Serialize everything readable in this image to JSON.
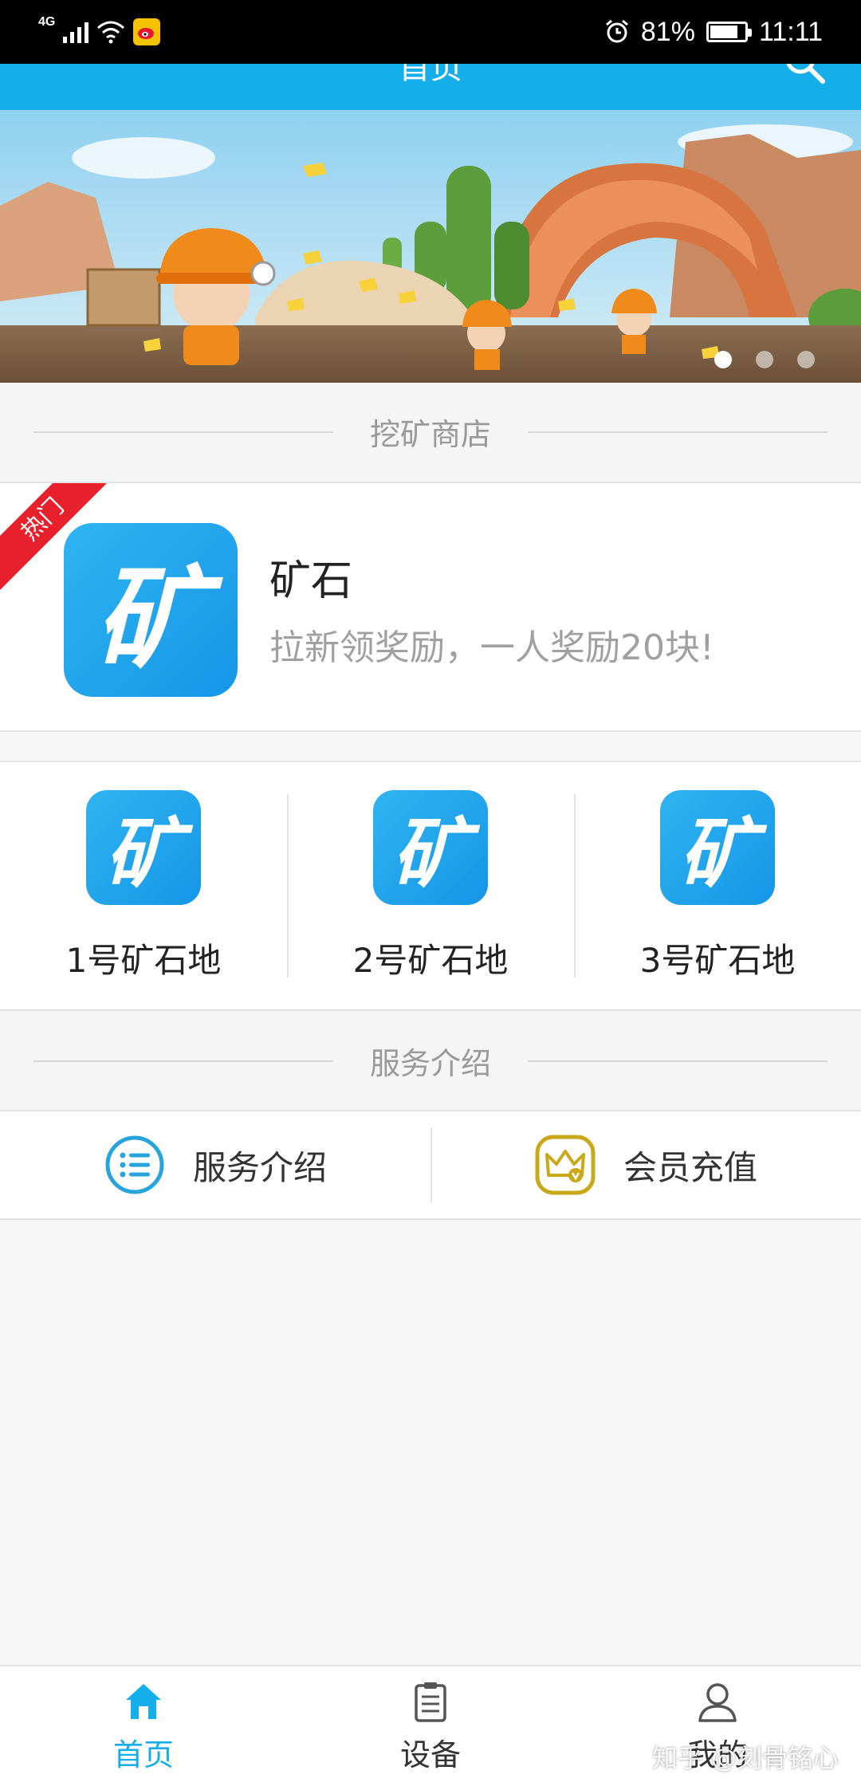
{
  "status_bar": {
    "network": "4G",
    "battery": "81%",
    "time": "11:11",
    "battery_level": 0.81
  },
  "header": {
    "title": "首页",
    "search_icon": "search-icon"
  },
  "banner": {
    "dots_count": 3,
    "active_index": 0
  },
  "store_section": {
    "title": "挖矿商店"
  },
  "featured": {
    "badge": "热门",
    "icon_text": "矿",
    "name": "矿石",
    "description": "拉新领奖励，一人奖励20块!"
  },
  "mining_sites": [
    {
      "icon_text": "矿",
      "label": "1号矿石地"
    },
    {
      "icon_text": "矿",
      "label": "2号矿石地"
    },
    {
      "icon_text": "矿",
      "label": "3号矿石地"
    }
  ],
  "service_section": {
    "title": "服务介绍"
  },
  "services": [
    {
      "label": "服务介绍",
      "icon": "list-icon"
    },
    {
      "label": "会员充值",
      "icon": "crown-icon"
    }
  ],
  "bottom_nav": [
    {
      "label": "首页",
      "icon": "home-icon",
      "active": true
    },
    {
      "label": "设备",
      "icon": "clipboard-icon",
      "active": false
    },
    {
      "label": "我的",
      "icon": "user-icon",
      "active": false
    }
  ],
  "watermark": "知乎 @刻骨铭心",
  "colors": {
    "primary": "#14aeea",
    "hot_badge": "#e8202c",
    "list_icon": "#27a4dc",
    "crown_icon": "#c9a91a"
  }
}
